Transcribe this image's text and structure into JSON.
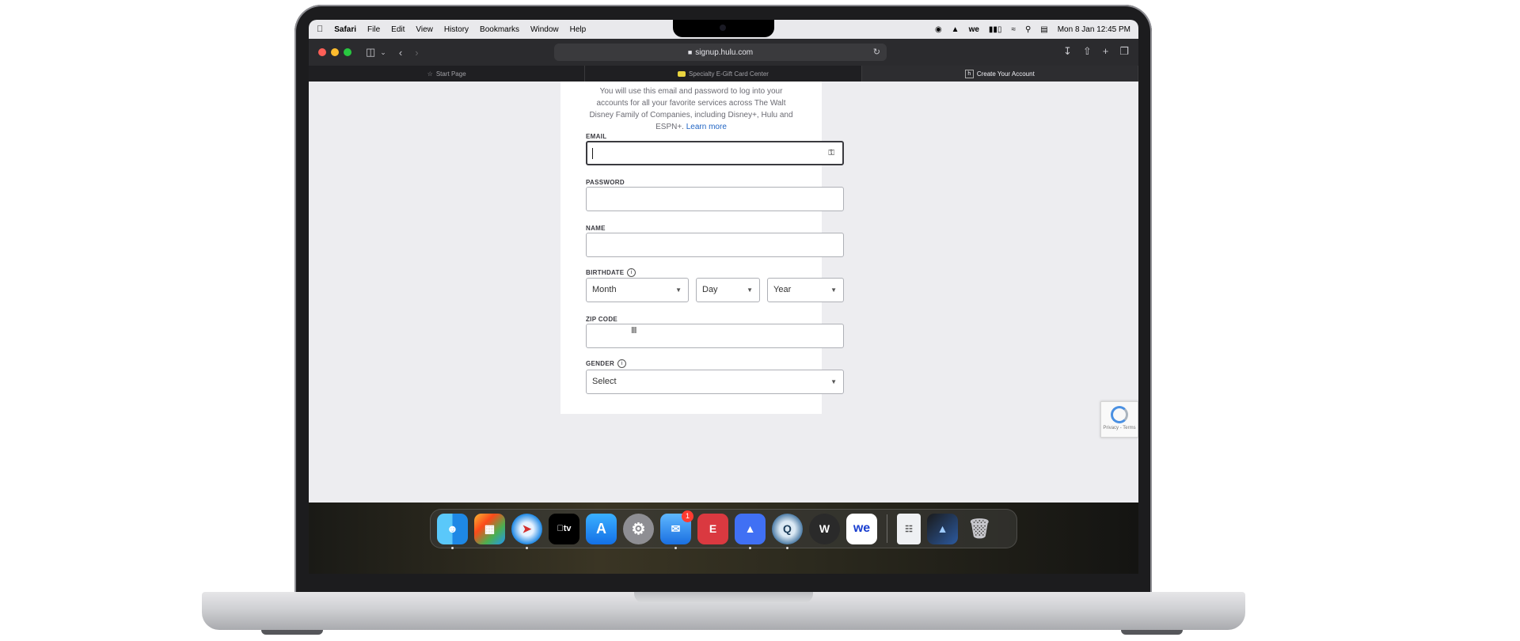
{
  "menubar": {
    "apple": "",
    "items": [
      "Safari",
      "File",
      "Edit",
      "View",
      "History",
      "Bookmarks",
      "Window",
      "Help"
    ],
    "datetime": "Mon 8 Jan  12:45 PM"
  },
  "browser": {
    "url": "signup.hulu.com",
    "tabs": [
      {
        "label": "Start Page"
      },
      {
        "label": "Specialty E-Gift Card Center"
      },
      {
        "label": "Create Your Account"
      }
    ]
  },
  "form": {
    "intro_text": "You will use this email and password to log into your accounts for all your favorite services across The Walt Disney Family of Companies, including Disney+, Hulu and ESPN+.",
    "learn_more": "Learn more",
    "email_label": "EMAIL",
    "password_label": "PASSWORD",
    "name_label": "NAME",
    "birthdate_label": "BIRTHDATE",
    "month_value": "Month",
    "day_value": "Day",
    "year_value": "Year",
    "zip_label": "ZIP CODE",
    "gender_label": "GENDER",
    "gender_value": "Select"
  },
  "recaptcha": {
    "text": "Privacy - Terms"
  },
  "dock": {
    "mail_badge": "1",
    "apps": [
      "Finder",
      "Launchpad",
      "Safari",
      "Apple TV",
      "App Store",
      "System Settings",
      "Mail",
      "ExpressVPN",
      "NordVPN",
      "QuickTime Player",
      "Wondershare",
      "WeTransfer",
      "Document",
      "Downloads",
      "Trash"
    ]
  },
  "colors": {
    "link": "#2165c4",
    "dock_badge": "#ff3b30"
  }
}
